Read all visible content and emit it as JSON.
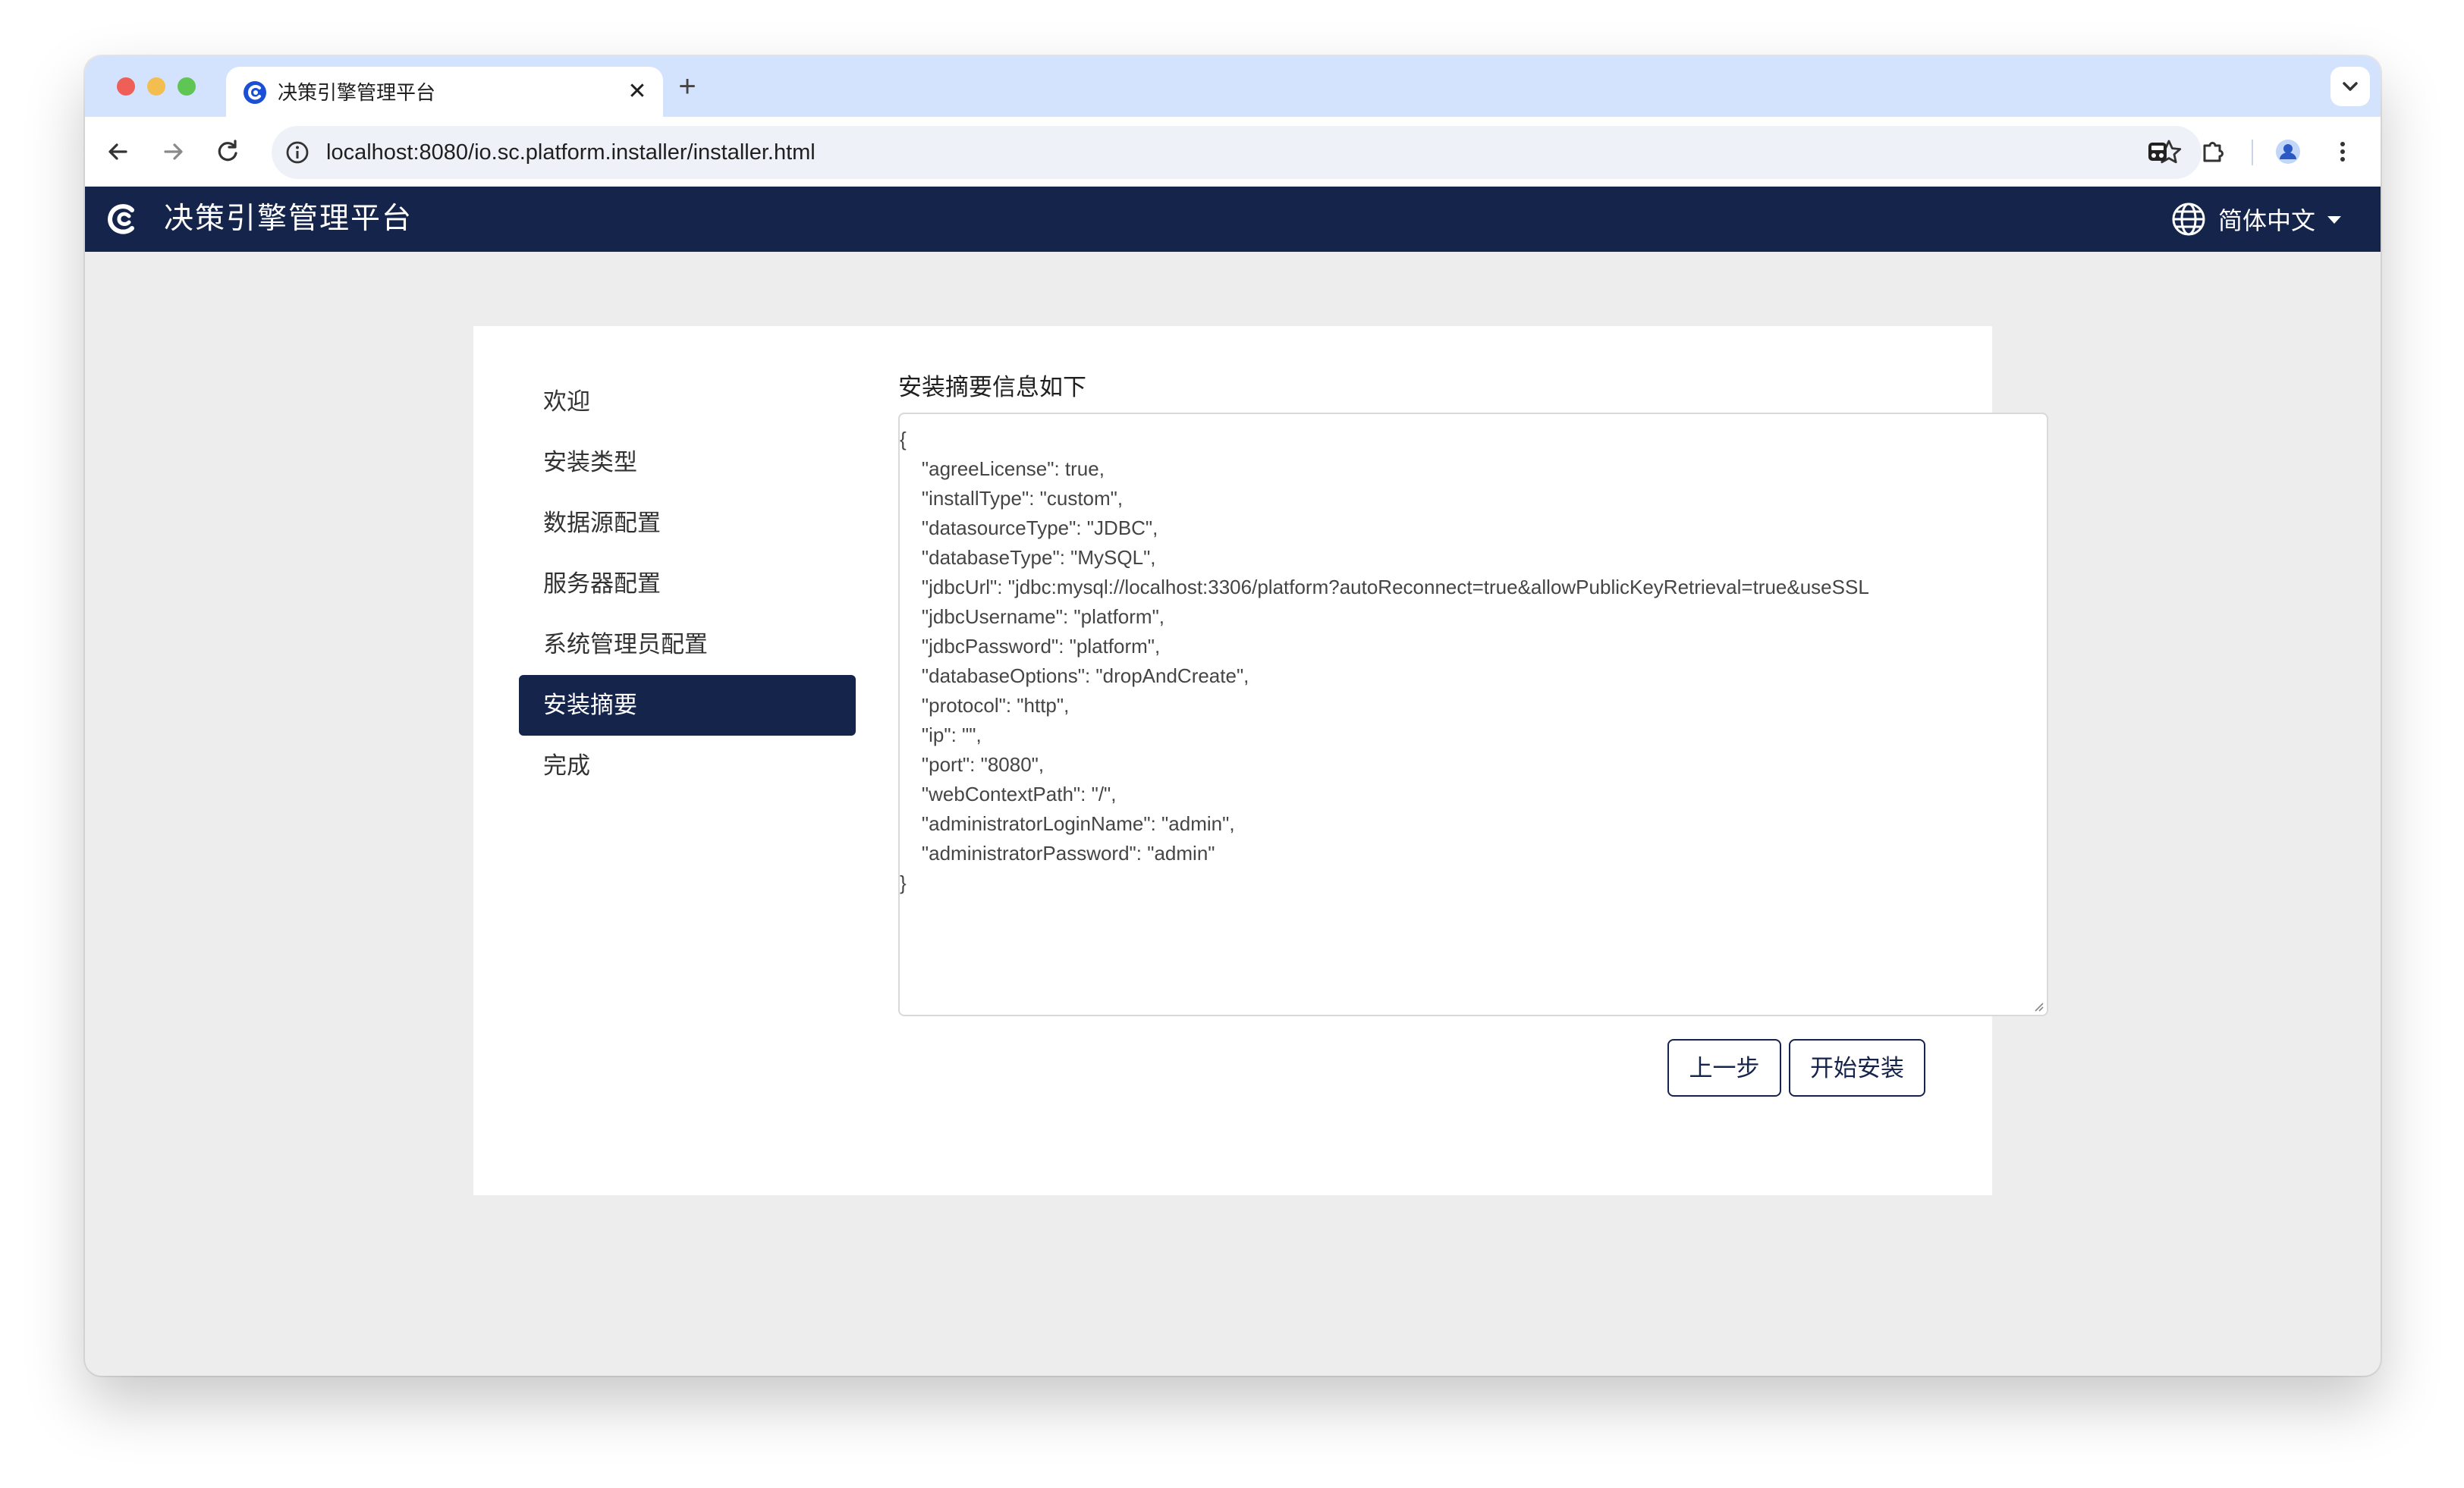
{
  "browser": {
    "tab_title": "决策引擎管理平台",
    "url": "localhost:8080/io.sc.platform.installer/installer.html"
  },
  "app": {
    "title": "决策引擎管理平台",
    "language": "简体中文"
  },
  "steps": [
    {
      "label": "欢迎",
      "active": false
    },
    {
      "label": "安装类型",
      "active": false
    },
    {
      "label": "数据源配置",
      "active": false
    },
    {
      "label": "服务器配置",
      "active": false
    },
    {
      "label": "系统管理员配置",
      "active": false
    },
    {
      "label": "安装摘要",
      "active": true
    },
    {
      "label": "完成",
      "active": false
    }
  ],
  "summary": {
    "label": "安装摘要信息如下",
    "content": "{\n    \"agreeLicense\": true,\n    \"installType\": \"custom\",\n    \"datasourceType\": \"JDBC\",\n    \"databaseType\": \"MySQL\",\n    \"jdbcUrl\": \"jdbc:mysql://localhost:3306/platform?autoReconnect=true&allowPublicKeyRetrieval=true&useSSL\n    \"jdbcUsername\": \"platform\",\n    \"jdbcPassword\": \"platform\",\n    \"databaseOptions\": \"dropAndCreate\",\n    \"protocol\": \"http\",\n    \"ip\": \"\",\n    \"port\": \"8080\",\n    \"webContextPath\": \"/\",\n    \"administratorLoginName\": \"admin\",\n    \"administratorPassword\": \"admin\"\n}"
  },
  "buttons": {
    "prev": "上一步",
    "install": "开始安装"
  },
  "colors": {
    "header_bg": "#15244b",
    "active_step_bg": "#15244b",
    "page_bg": "#ededed",
    "tabstrip_bg": "#d3e3fd"
  },
  "icons": {
    "tab_favicon": "app-logo-icon",
    "tab_close": "close-icon",
    "new_tab": "plus-icon",
    "back": "arrow-left-icon",
    "forward": "arrow-right-icon",
    "reload": "reload-icon",
    "site_info": "info-icon",
    "bookmark": "star-icon",
    "language": "globe-icon",
    "profile": "profile-icon",
    "menu": "kebab-menu-icon"
  }
}
